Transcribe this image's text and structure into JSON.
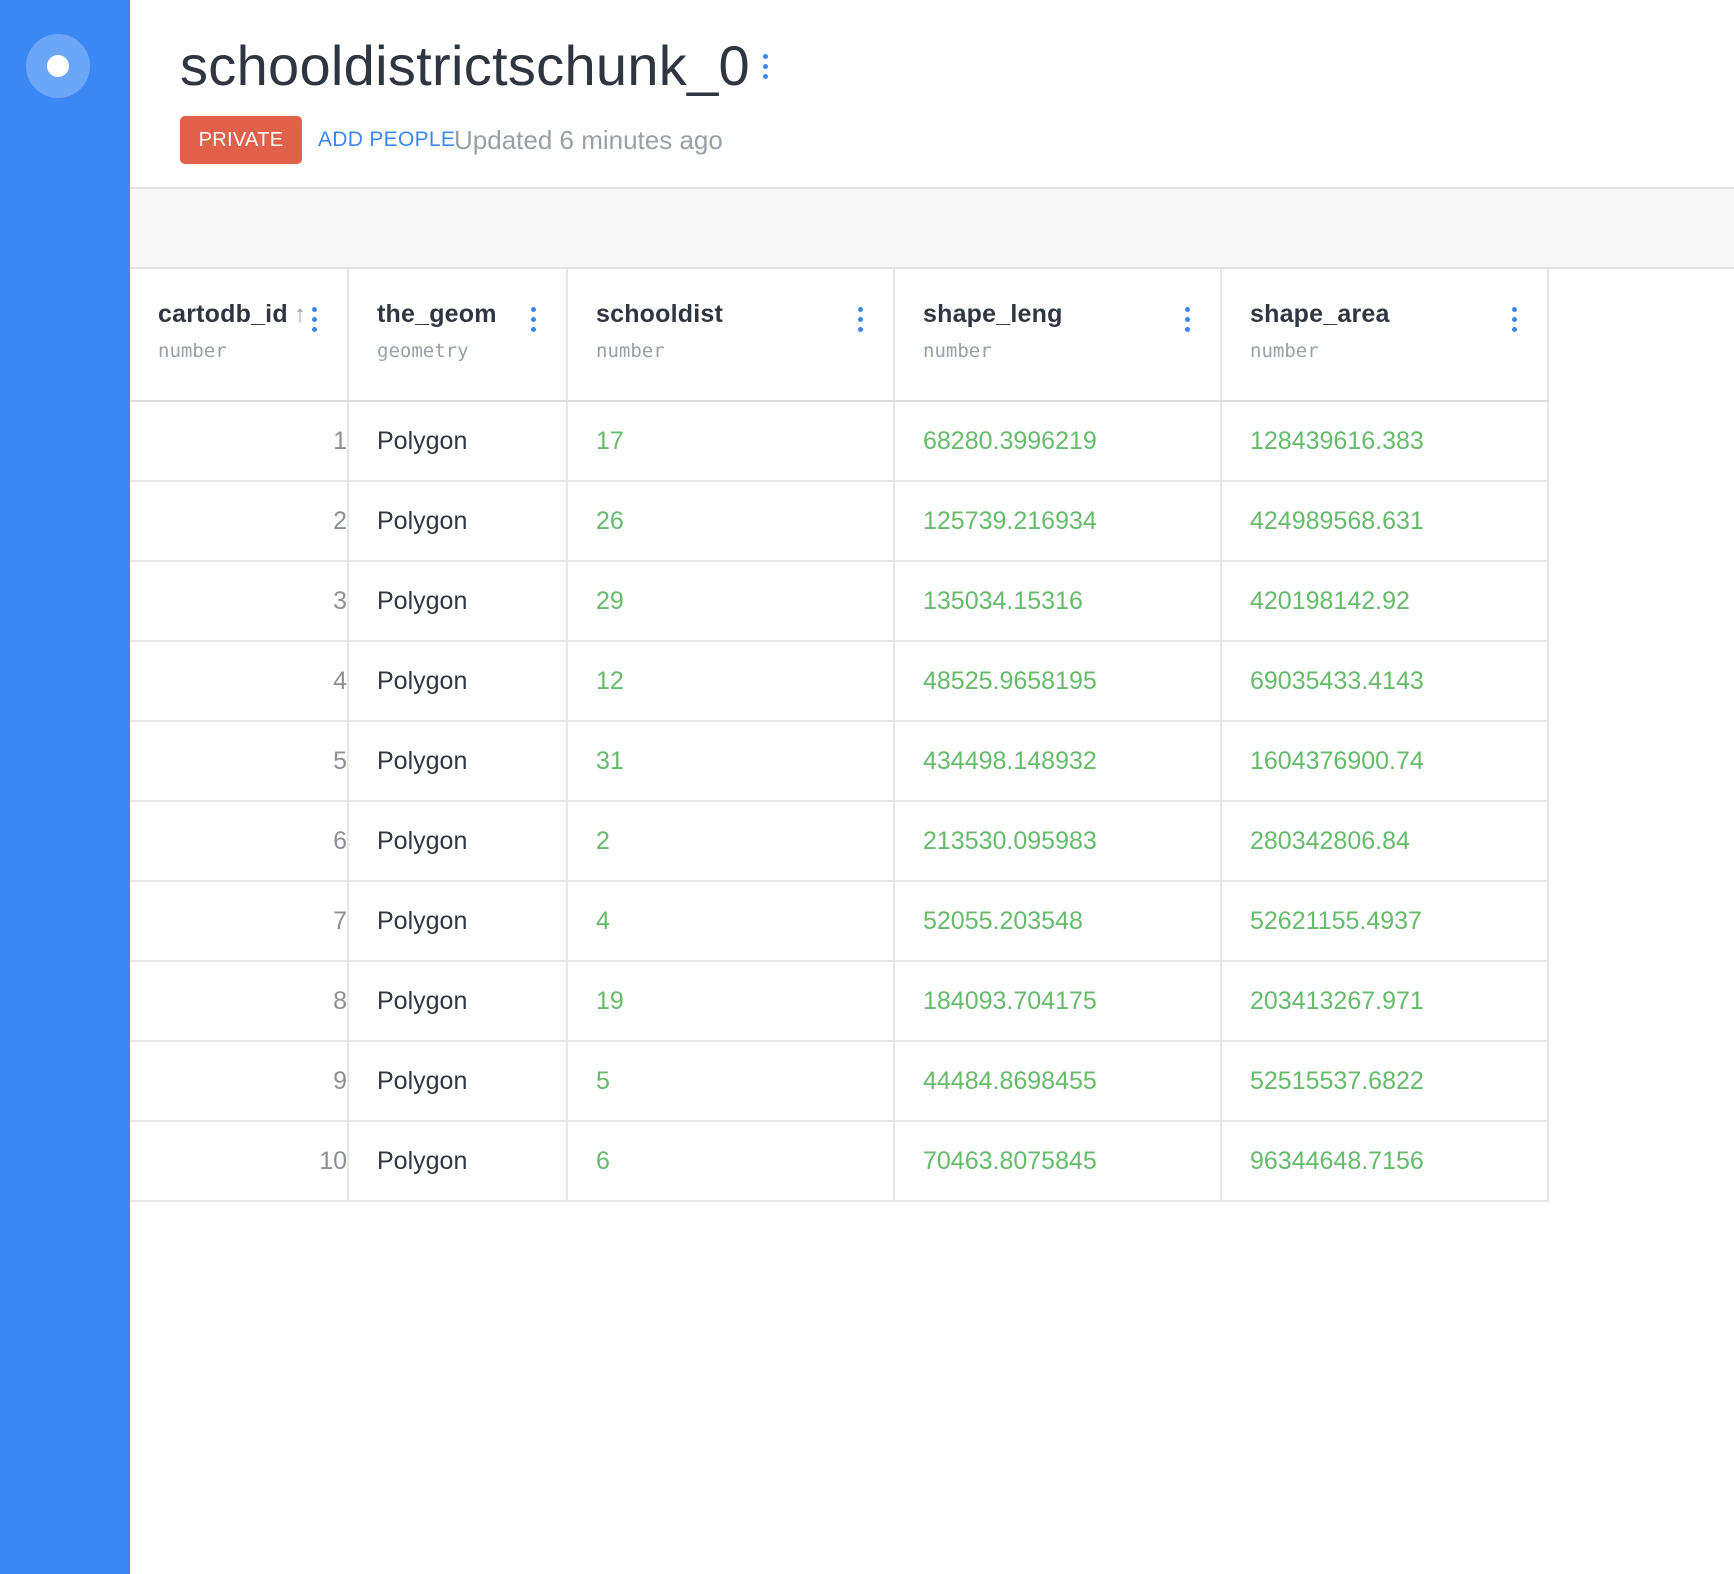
{
  "dataset": {
    "title": "schooldistrictschunk_0",
    "privacy_label": "PRIVATE",
    "add_people_label": "ADD PEOPLE",
    "updated_text": "Updated 6 minutes ago"
  },
  "colors": {
    "sidebar": "#3b88f4",
    "accent": "#3b88f4",
    "private_badge": "#e0604a",
    "numeric_value": "#66bb6a"
  },
  "table": {
    "columns": [
      {
        "name": "cartodb_id",
        "type": "number",
        "sorted": "ascending"
      },
      {
        "name": "the_geom",
        "type": "geometry"
      },
      {
        "name": "schooldist",
        "type": "number"
      },
      {
        "name": "shape_leng",
        "type": "number"
      },
      {
        "name": "shape_area",
        "type": "number"
      }
    ],
    "rows": [
      {
        "cartodb_id": "1",
        "the_geom": "Polygon",
        "schooldist": "17",
        "shape_leng": "68280.3996219",
        "shape_area": "128439616.383"
      },
      {
        "cartodb_id": "2",
        "the_geom": "Polygon",
        "schooldist": "26",
        "shape_leng": "125739.216934",
        "shape_area": "424989568.631"
      },
      {
        "cartodb_id": "3",
        "the_geom": "Polygon",
        "schooldist": "29",
        "shape_leng": "135034.15316",
        "shape_area": "420198142.92"
      },
      {
        "cartodb_id": "4",
        "the_geom": "Polygon",
        "schooldist": "12",
        "shape_leng": "48525.9658195",
        "shape_area": "69035433.4143"
      },
      {
        "cartodb_id": "5",
        "the_geom": "Polygon",
        "schooldist": "31",
        "shape_leng": "434498.148932",
        "shape_area": "1604376900.74"
      },
      {
        "cartodb_id": "6",
        "the_geom": "Polygon",
        "schooldist": "2",
        "shape_leng": "213530.095983",
        "shape_area": "280342806.84"
      },
      {
        "cartodb_id": "7",
        "the_geom": "Polygon",
        "schooldist": "4",
        "shape_leng": "52055.203548",
        "shape_area": "52621155.4937"
      },
      {
        "cartodb_id": "8",
        "the_geom": "Polygon",
        "schooldist": "19",
        "shape_leng": "184093.704175",
        "shape_area": "203413267.971"
      },
      {
        "cartodb_id": "9",
        "the_geom": "Polygon",
        "schooldist": "5",
        "shape_leng": "44484.8698455",
        "shape_area": "52515537.6822"
      },
      {
        "cartodb_id": "10",
        "the_geom": "Polygon",
        "schooldist": "6",
        "shape_leng": "70463.8075845",
        "shape_area": "96344648.7156"
      }
    ]
  }
}
